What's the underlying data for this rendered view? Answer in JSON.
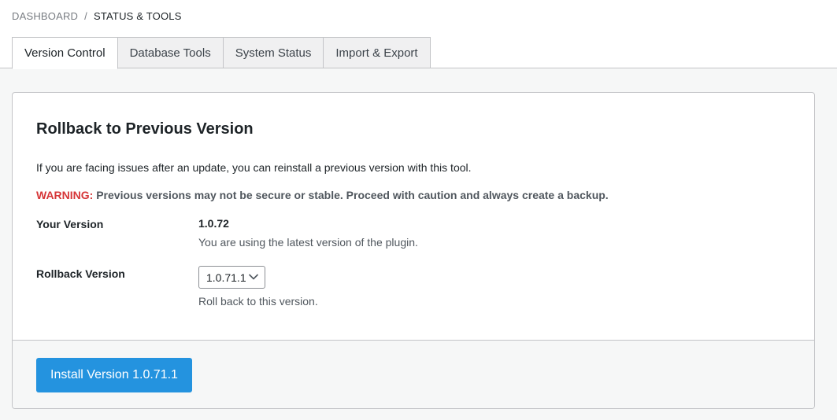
{
  "breadcrumb": {
    "root": "DASHBOARD",
    "separator": "/",
    "current": "STATUS & TOOLS"
  },
  "tabs": [
    {
      "label": "Version Control",
      "active": true
    },
    {
      "label": "Database Tools",
      "active": false
    },
    {
      "label": "System Status",
      "active": false
    },
    {
      "label": "Import & Export",
      "active": false
    }
  ],
  "card": {
    "title": "Rollback to Previous Version",
    "description": "If you are facing issues after an update, you can reinstall a previous version with this tool.",
    "warning_label": "WARNING:",
    "warning_text": " Previous versions may not be secure or stable. Proceed with caution and always create a backup.",
    "your_version": {
      "label": "Your Version",
      "value": "1.0.72",
      "help": "You are using the latest version of the plugin."
    },
    "rollback_version": {
      "label": "Rollback Version",
      "selected": "1.0.71.1",
      "help": "Roll back to this version."
    },
    "install_button": "Install Version 1.0.71.1"
  },
  "colors": {
    "accent": "#2493df",
    "warning": "#d63638"
  },
  "icons": {
    "select_arrow": "chevron-down-icon"
  }
}
